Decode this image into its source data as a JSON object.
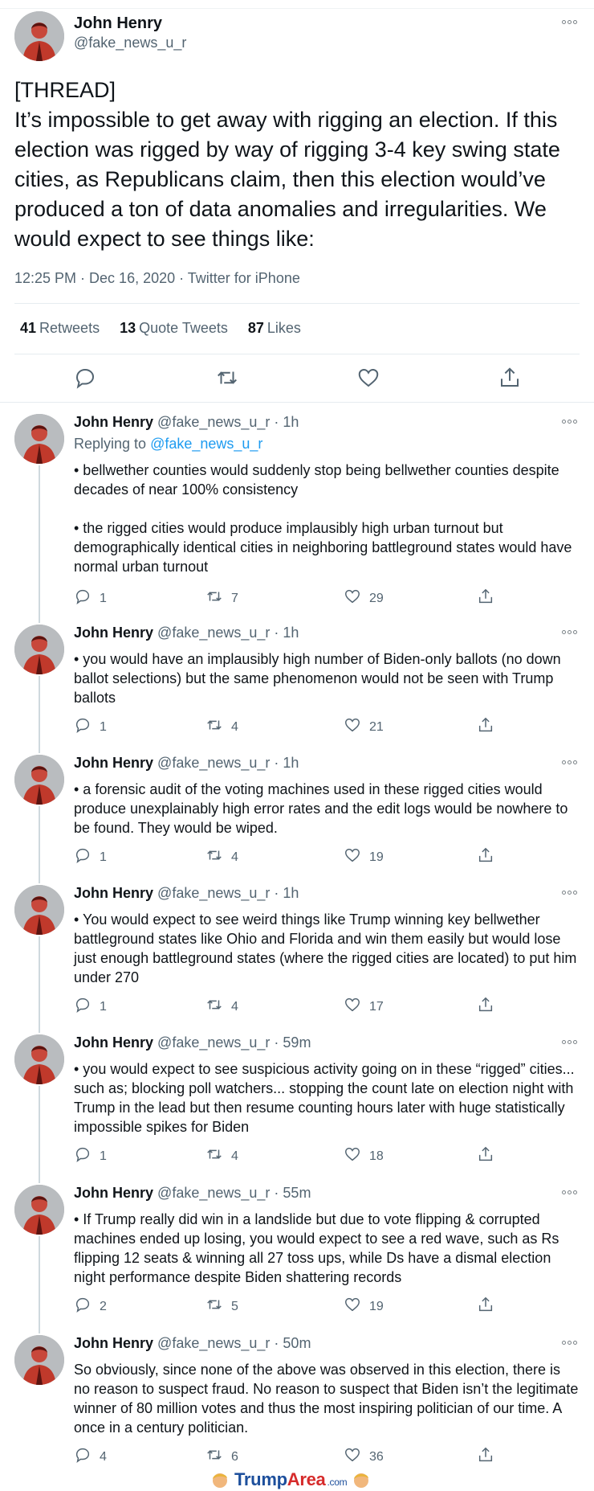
{
  "main_tweet": {
    "name": "John Henry",
    "handle": "@fake_news_u_r",
    "text": "[THREAD]\nIt’s impossible to get away with rigging an election. If this election was rigged by way of rigging 3-4 key swing state cities, as Republicans claim, then this election would’ve produced a ton of data anomalies and irregularities. We would expect to see things like:",
    "meta": "12:25 PM · Dec 16, 2020 · Twitter for iPhone",
    "retweets_count": "41",
    "retweets_label": "Retweets",
    "quotes_count": "13",
    "quotes_label": "Quote Tweets",
    "likes_count": "87",
    "likes_label": "Likes"
  },
  "replies": [
    {
      "name": "John Henry",
      "handle": "@fake_news_u_r",
      "time": "· 1h",
      "replying_prefix": "Replying to",
      "replying_to": "@fake_news_u_r",
      "text": "• bellwether counties would suddenly stop being bellwether counties despite decades of near 100% consistency\n\n• the rigged cities would produce implausibly high urban turnout but demographically identical cities in neighboring battleground states would have normal urban turnout",
      "replies": "1",
      "retweets": "7",
      "likes": "29"
    },
    {
      "name": "John Henry",
      "handle": "@fake_news_u_r",
      "time": "· 1h",
      "text": "• you would have an implausibly high number of Biden-only ballots (no down ballot selections) but the same phenomenon would not be seen with Trump ballots",
      "replies": "1",
      "retweets": "4",
      "likes": "21"
    },
    {
      "name": "John Henry",
      "handle": "@fake_news_u_r",
      "time": "· 1h",
      "text": "• a forensic audit of the voting machines used in these rigged cities would produce unexplainably high error rates and the edit logs would be nowhere to be found. They would be wiped.",
      "replies": "1",
      "retweets": "4",
      "likes": "19"
    },
    {
      "name": "John Henry",
      "handle": "@fake_news_u_r",
      "time": "· 1h",
      "text": "• You would expect to see weird things like Trump winning key bellwether battleground states like Ohio and Florida and win them easily but would lose just enough battleground states (where the rigged cities are located) to put him under 270",
      "replies": "1",
      "retweets": "4",
      "likes": "17"
    },
    {
      "name": "John Henry",
      "handle": "@fake_news_u_r",
      "time": "· 59m",
      "text": "• you would expect to see suspicious activity going on in these “rigged” cities... such as; blocking poll watchers... stopping the count late on election night with Trump in the lead but then resume counting hours later with huge statistically impossible spikes for Biden",
      "replies": "1",
      "retweets": "4",
      "likes": "18"
    },
    {
      "name": "John Henry",
      "handle": "@fake_news_u_r",
      "time": "· 55m",
      "text": "• If Trump really did win in a landslide but due to vote flipping & corrupted machines ended up losing, you would expect to see a red wave, such as Rs flipping 12 seats & winning all 27 toss ups, while Ds have a dismal election night performance despite Biden shattering records",
      "replies": "2",
      "retweets": "5",
      "likes": "19"
    },
    {
      "name": "John Henry",
      "handle": "@fake_news_u_r",
      "time": "· 50m",
      "text": "So obviously, since none of the above was observed in this election, there is no reason to suspect fraud. No reason to suspect that Biden isn’t the legitimate winner of 80 million votes and thus the most inspiring politician of our time. A once in a century politician.",
      "replies": "4",
      "retweets": "6",
      "likes": "36"
    }
  ],
  "watermark": {
    "trump": "Trump",
    "area": "Area",
    "com": ".com"
  },
  "colors": {
    "link": "#1d9bf0",
    "muted": "#536471",
    "text": "#0f1419"
  },
  "icons": [
    "more-icon",
    "reply-icon",
    "retweet-icon",
    "like-icon",
    "share-icon"
  ]
}
